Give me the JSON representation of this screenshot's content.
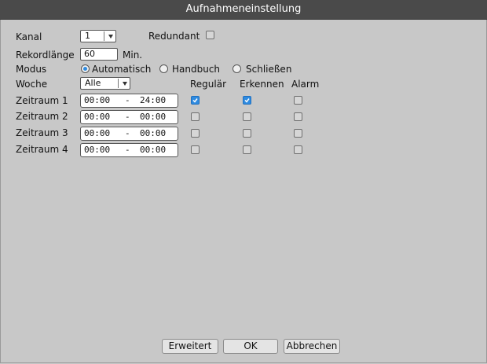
{
  "window": {
    "title": "Aufnahmeneinstellung"
  },
  "kanal": {
    "label": "Kanal",
    "value": "1"
  },
  "redundant": {
    "label": "Redundant",
    "checked": false
  },
  "rekord": {
    "label": "Rekordlänge",
    "value": "60",
    "unit": "Min."
  },
  "modus": {
    "label": "Modus",
    "options": [
      {
        "label": "Automatisch",
        "selected": true
      },
      {
        "label": "Handbuch",
        "selected": false
      },
      {
        "label": "Schließen",
        "selected": false
      }
    ]
  },
  "woche": {
    "label": "Woche",
    "value": "Alle"
  },
  "columns": {
    "regular": "Regulär",
    "detect": "Erkennen",
    "alarm": "Alarm"
  },
  "periods": [
    {
      "label": "Zeitraum 1",
      "start": "00:00",
      "sep": "-",
      "end": "24:00",
      "regular": true,
      "detect": true,
      "alarm": false
    },
    {
      "label": "Zeitraum 2",
      "start": "00:00",
      "sep": "-",
      "end": "00:00",
      "regular": false,
      "detect": false,
      "alarm": false
    },
    {
      "label": "Zeitraum 3",
      "start": "00:00",
      "sep": "-",
      "end": "00:00",
      "regular": false,
      "detect": false,
      "alarm": false
    },
    {
      "label": "Zeitraum 4",
      "start": "00:00",
      "sep": "-",
      "end": "00:00",
      "regular": false,
      "detect": false,
      "alarm": false
    }
  ],
  "buttons": {
    "advanced": "Erweitert",
    "ok": "OK",
    "cancel": "Abbrechen"
  },
  "colors": {
    "accent": "#2f8be0",
    "titlebar": "#4a4a4a",
    "panel": "#c8c8c8"
  }
}
